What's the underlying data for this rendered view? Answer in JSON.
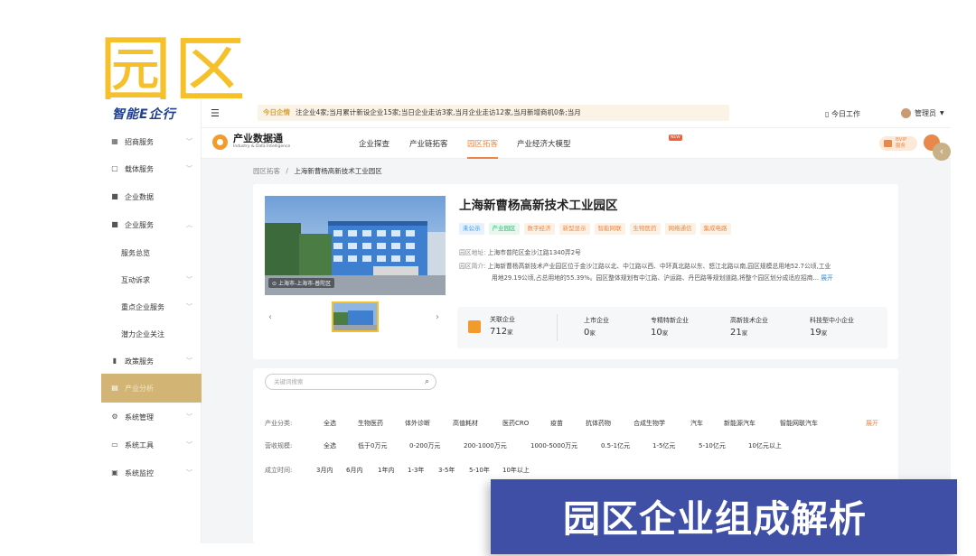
{
  "page": {
    "big_title": "园区",
    "banner_text": "园区企业组成解析"
  },
  "app": {
    "logo": "智能E企行",
    "topbar": {
      "ticker_tag": "今日企情",
      "ticker_text": "注企业4家;当月累计新设企业15家;当日企业走访3家,当月企业走访12家,当月新增商机0条;当月",
      "today_work": "今日工作",
      "admin": "管理员"
    },
    "sidebar": {
      "items": [
        {
          "label": "招商服务",
          "icon": "briefcase-icon",
          "chevron": "﹀"
        },
        {
          "label": "载体服务",
          "icon": "building-icon",
          "chevron": "﹀"
        },
        {
          "label": "企业数据",
          "icon": "folder-icon",
          "chevron": ""
        },
        {
          "label": "企业服务",
          "icon": "folder-icon",
          "chevron": "︿"
        },
        {
          "label": "服务总览",
          "icon": "",
          "chevron": ""
        },
        {
          "label": "互动诉求",
          "icon": "",
          "chevron": "﹀"
        },
        {
          "label": "重点企业服务",
          "icon": "",
          "chevron": "﹀"
        },
        {
          "label": "潜力企业关注",
          "icon": "",
          "chevron": ""
        },
        {
          "label": "政策服务",
          "icon": "book-icon",
          "chevron": "﹀"
        },
        {
          "label": "产业分析",
          "icon": "chart-icon",
          "chevron": ""
        },
        {
          "label": "系统管理",
          "icon": "gear-icon",
          "chevron": "﹀"
        },
        {
          "label": "系统工具",
          "icon": "toolbox-icon",
          "chevron": "﹀"
        },
        {
          "label": "系统监控",
          "icon": "monitor-icon",
          "chevron": "﹀"
        }
      ]
    },
    "subnav": {
      "brand_cn": "产业数据通",
      "brand_en": "Industry & Data Intelligence",
      "tabs": [
        "企业探查",
        "产业链拓客",
        "园区拓客",
        "产业经济大模型"
      ],
      "new_badge": "NEW",
      "vip_line1": "BVIP",
      "vip_line2": "服务"
    },
    "breadcrumb": {
      "parent": "园区拓客",
      "sep": "/",
      "current": "上海新曹杨高新技术工业园区"
    },
    "park": {
      "name": "上海新曹杨高新技术工业园区",
      "photo_location": "上海市-上海市-普陀区",
      "tags": [
        "未公示",
        "产业园区",
        "数字经济",
        "新型显示",
        "智能网联",
        "生物医药",
        "网络通信",
        "集成电路"
      ],
      "address_label": "园区地址:",
      "address": "上海市普陀区金沙江路1340弄2号",
      "intro_label": "园区简介:",
      "intro_line1": "上海新曹杨高新技术产业园区位于金沙江路以北、中江路以西、中环真北路以东、怒江北路以南,园区规模总用地52.7公顷,工业",
      "intro_line2": "用地29.19公顷,占总用地的55.39%。园区整体规划有中江路、沪运路、丹巴路等规划道路,将整个园区划分成适应招商...",
      "more": "展开",
      "stats": {
        "main_label": "关联企业",
        "main_value": "712",
        "main_unit": "家",
        "items": [
          {
            "label": "上市企业",
            "value": "0",
            "unit": "家"
          },
          {
            "label": "专精特新企业",
            "value": "10",
            "unit": "家"
          },
          {
            "label": "高新技术企业",
            "value": "21",
            "unit": "家"
          },
          {
            "label": "科技型中小企业",
            "value": "19",
            "unit": "家"
          }
        ]
      }
    },
    "filter": {
      "search_placeholder": "关键词搜索",
      "industry_label": "产业分类:",
      "industry_options": [
        "全选",
        "生物医药",
        "体外诊断",
        "高值耗材",
        "医药CRO",
        "疫苗",
        "抗体药物",
        "合成生物学",
        "汽车",
        "新能源汽车",
        "智能网联汽车"
      ],
      "expand": "展开",
      "revenue_label": "营收规模:",
      "revenue_options": [
        "全选",
        "低于0万元",
        "0-200万元",
        "200-1000万元",
        "1000-5000万元",
        "0.5-1亿元",
        "1-5亿元",
        "5-10亿元",
        "10亿元以上"
      ],
      "founded_label": "成立时间:",
      "founded_options": [
        "3月内",
        "6月内",
        "1年内",
        "1-3年",
        "3-5年",
        "5-10年",
        "10年以上"
      ]
    }
  }
}
